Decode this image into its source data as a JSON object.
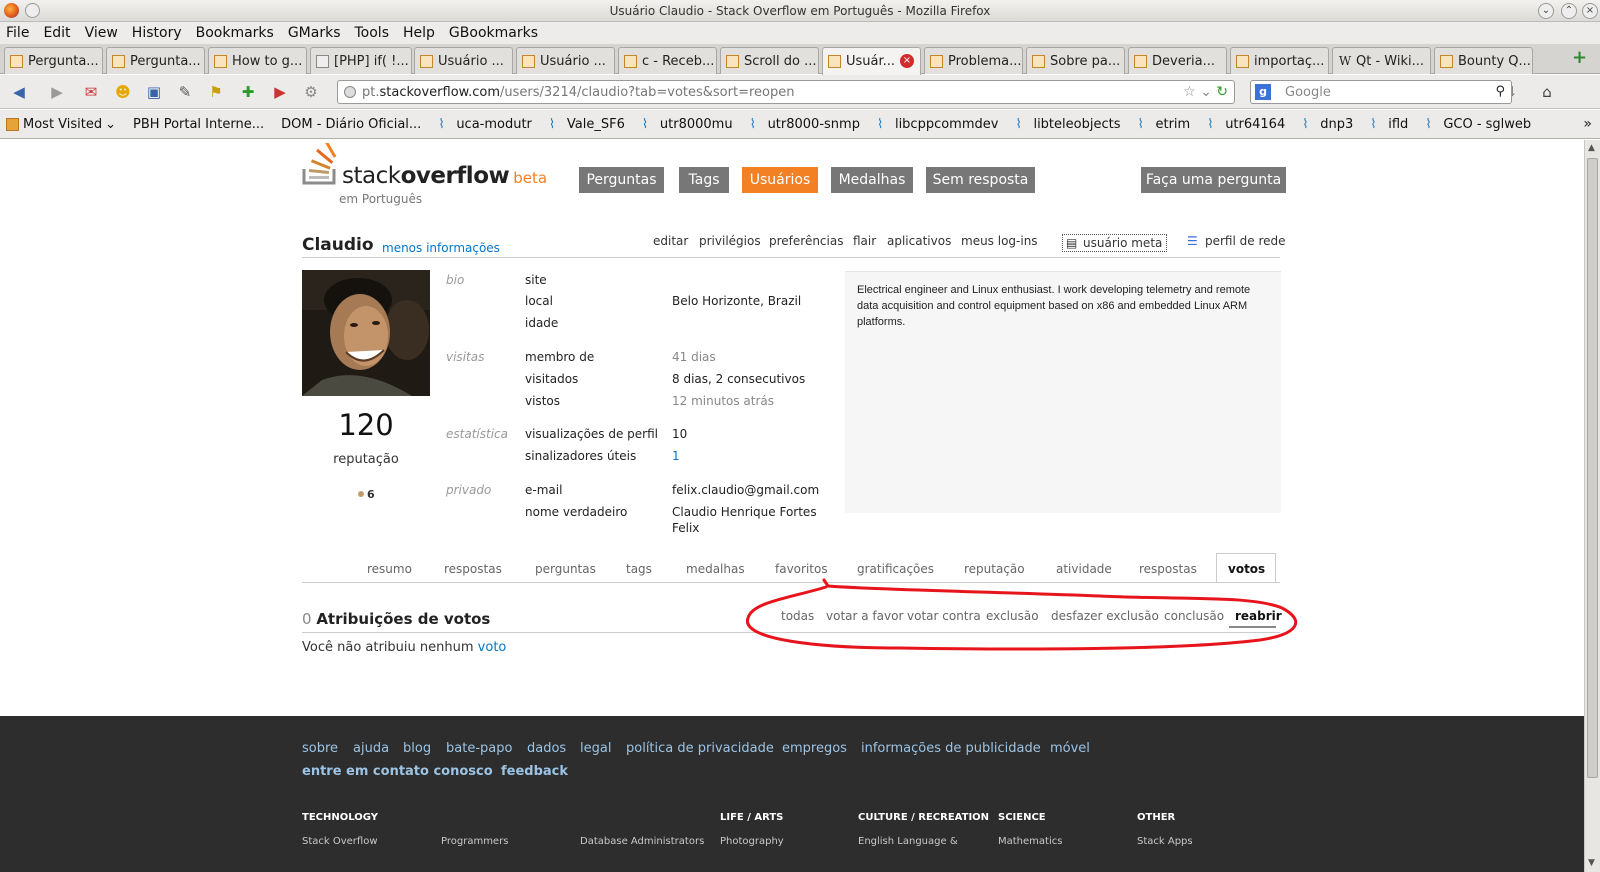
{
  "window": {
    "title": "Usuário Claudio - Stack Overflow em Português - Mozilla Firefox"
  },
  "menubar": [
    "File",
    "Edit",
    "View",
    "History",
    "Bookmarks",
    "GMarks",
    "Tools",
    "Help",
    "GBookmarks"
  ],
  "tabs": [
    {
      "label": "Pergunta..."
    },
    {
      "label": "Pergunta..."
    },
    {
      "label": "How to g..."
    },
    {
      "label": "[PHP] if( !..."
    },
    {
      "label": "Usuário ..."
    },
    {
      "label": "Usuário ..."
    },
    {
      "label": "c - Receb..."
    },
    {
      "label": "Scroll do ..."
    },
    {
      "label": "Usuár..."
    },
    {
      "label": "Problema..."
    },
    {
      "label": "Sobre pa..."
    },
    {
      "label": "Deveria..."
    },
    {
      "label": "importaç..."
    },
    {
      "label": "Qt - Wiki..."
    },
    {
      "label": "Bounty Q..."
    }
  ],
  "urlbar": {
    "prefix": "pt.",
    "host": "stackoverflow.com",
    "path": "/users/3214/claudio?tab=votes&sort=reopen"
  },
  "search": {
    "placeholder": "Google"
  },
  "bookmarks": [
    "Most Visited",
    "PBH Portal Interne...",
    "DOM - Diário Oficial...",
    "uca-modutr",
    "Vale_SF6",
    "utr8000mu",
    "utr8000-snmp",
    "libcppcommdev",
    "libteleobjects",
    "etrim",
    "utr64164",
    "dnp3",
    "ifld",
    "GCO - sglweb"
  ],
  "site": {
    "logo_left": "stack",
    "logo_right": "overflow",
    "logo_beta": "beta",
    "logo_sub": "em Português",
    "nav": [
      "Perguntas",
      "Tags",
      "Usuários",
      "Medalhas",
      "Sem resposta"
    ],
    "ask": "Faça uma pergunta"
  },
  "user": {
    "name": "Claudio",
    "toggle": "menos informações",
    "actions": [
      "editar",
      "privilégios",
      "preferências",
      "flair",
      "aplicativos",
      "meus log-ins",
      "usuário meta",
      "perfil de rede"
    ],
    "reputation": "120",
    "reputation_label": "reputação",
    "bronze_badges": "6",
    "sections": {
      "bio": "bio",
      "visits": "visitas",
      "stats": "estatística",
      "private": "privado"
    },
    "fields": {
      "site": "site",
      "location": "local",
      "location_value": "Belo Horizonte, Brazil",
      "age": "idade",
      "member": "membro de",
      "member_value": "41 dias",
      "visited": "visitados",
      "visited_value": "8 dias, 2 consecutivos",
      "seen": "vistos",
      "seen_value": "12 minutos atrás",
      "profile_views": "visualizações de perfil",
      "profile_views_value": "10",
      "helpful_flags": "sinalizadores úteis",
      "helpful_flags_value": "1",
      "email": "e-mail",
      "email_value": "felix.claudio@gmail.com",
      "real_name": "nome verdadeiro",
      "real_name_value_1": "Claudio Henrique Fortes",
      "real_name_value_2": "Felix"
    },
    "about": "Electrical engineer and Linux enthusiast. I work developing telemetry and remote data acquisition and control equipment based on x86 and embedded Linux ARM platforms."
  },
  "profile_tabs": [
    "resumo",
    "respostas",
    "perguntas",
    "tags",
    "medalhas",
    "favoritos",
    "gratificações",
    "reputação",
    "atividade",
    "respostas",
    "votos"
  ],
  "votes": {
    "count": "0",
    "title": "Atribuições de votos",
    "filters": [
      "todas",
      "votar a favor",
      "votar contra",
      "exclusão",
      "desfazer exclusão",
      "conclusão",
      "reabrir"
    ],
    "empty_prefix": "Você não atribuiu nenhum",
    "empty_link": "voto"
  },
  "footer": {
    "links": [
      "sobre",
      "ajuda",
      "blog",
      "bate-papo",
      "dados",
      "legal",
      "política de privacidade",
      "empregos",
      "informações de publicidade",
      "móvel"
    ],
    "links2": [
      "entre em contato conosco",
      "feedback"
    ],
    "categories": [
      "TECHNOLOGY",
      "LIFE / ARTS",
      "CULTURE / RECREATION",
      "SCIENCE",
      "OTHER"
    ],
    "sites": [
      "Stack Overflow",
      "Programmers",
      "Database Administrators",
      "Photography",
      "English Language &",
      "Mathematics",
      "Stack Apps"
    ]
  },
  "colors": {
    "accent": "#f48024",
    "link": "#0077cc",
    "annotation": "#e8141b",
    "footer_bg": "#2d2d2d"
  }
}
